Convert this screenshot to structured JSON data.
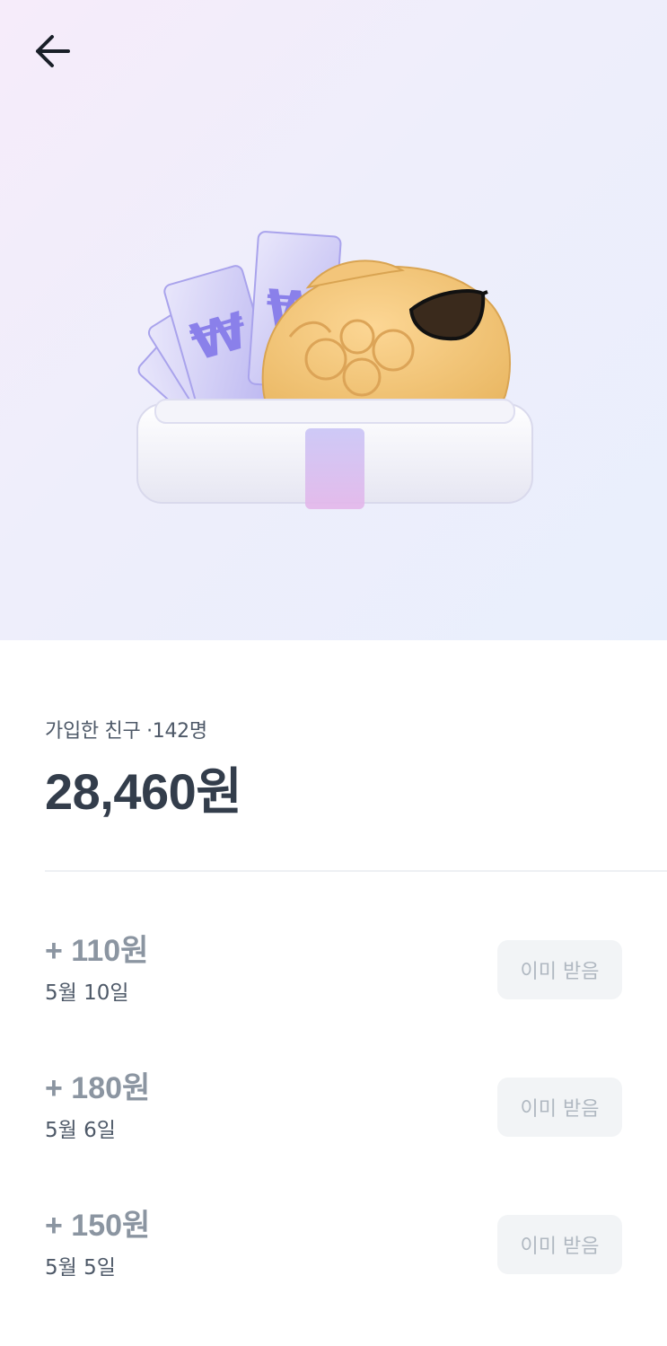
{
  "nav": {
    "back_icon": "arrow-left-icon"
  },
  "hero": {
    "illustration": "fish-bread-with-money-in-box"
  },
  "summary": {
    "label": "가입한 친구 ·142명",
    "amount": "28,460원"
  },
  "rewards": [
    {
      "amount": "+ 110원",
      "date": "5월 10일",
      "button_label": "이미 받음"
    },
    {
      "amount": "+ 180원",
      "date": "5월 6일",
      "button_label": "이미 받음"
    },
    {
      "amount": "+ 150원",
      "date": "5월 5일",
      "button_label": "이미 받음"
    }
  ],
  "colors": {
    "text_primary": "#333d4b",
    "text_muted": "#8b95a1",
    "button_bg": "#f2f4f6",
    "button_text": "#b0b8c1"
  }
}
